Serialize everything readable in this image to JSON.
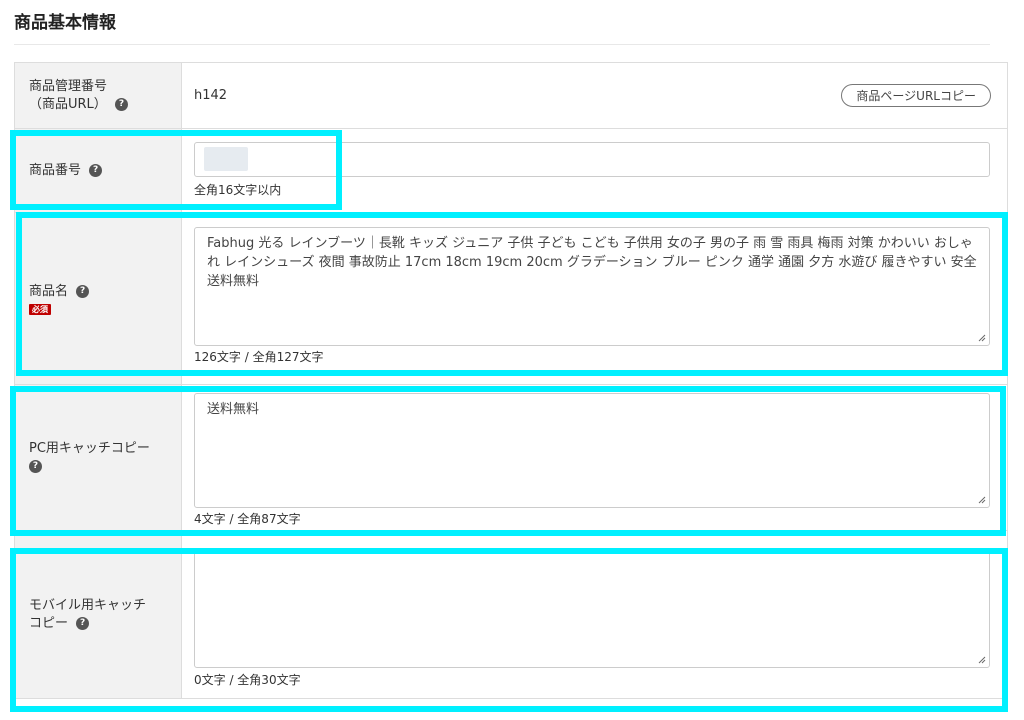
{
  "section": {
    "title": "商品基本情報"
  },
  "colors": {
    "highlight": "#00f0ff",
    "required": "#bf0000",
    "label_bg": "#f2f2f2"
  },
  "rows": {
    "product_url": {
      "label_line1": "商品管理番号",
      "label_line2": "（商品URL）",
      "value": "h142",
      "copy_button": "商品ページURLコピー"
    },
    "product_number": {
      "label": "商品番号",
      "value": "",
      "hint": "全角16文字以内"
    },
    "product_name": {
      "label": "商品名",
      "required_badge": "必須",
      "value": "Fabhug 光る レインブーツ｜長靴 キッズ ジュニア 子供 子ども こども 子供用 女の子 男の子 雨 雪 雨具 梅雨 対策 かわいい おしゃれ レインシューズ 夜間 事故防止 17cm 18cm 19cm 20cm グラデーション ブルー ピンク 通学 通園 夕方 水遊び 履きやすい 安全 送料無料",
      "counter": "126文字 / 全角127文字"
    },
    "pc_catch": {
      "label": "PC用キャッチコピー",
      "value": "送料無料",
      "counter": "4文字 / 全角87文字"
    },
    "mobile_catch": {
      "label_line1": "モバイル用キャッチ",
      "label_line2": "コピー",
      "value": "",
      "counter": "0文字 / 全角30文字"
    }
  },
  "icons": {
    "help": "question-circle-icon",
    "resize": "resize-grip-icon"
  }
}
